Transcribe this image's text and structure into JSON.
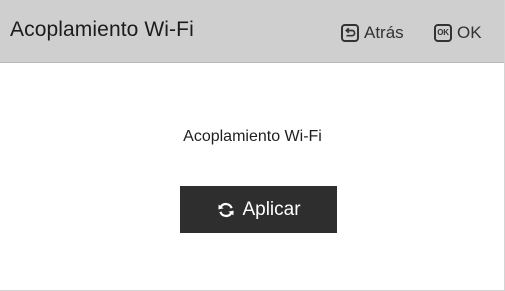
{
  "header": {
    "title": "Acoplamiento Wi-Fi",
    "back_label": "Atrás",
    "back_icon": "back-key-icon",
    "ok_key_text": "OK",
    "ok_label": "OK"
  },
  "main": {
    "label": "Acoplamiento Wi-Fi",
    "apply_button": {
      "label": "Aplicar",
      "icon": "refresh-icon"
    }
  },
  "colors": {
    "header_bg": "#cfcfcf",
    "button_bg": "#2e2e2e",
    "button_text": "#ffffff"
  }
}
